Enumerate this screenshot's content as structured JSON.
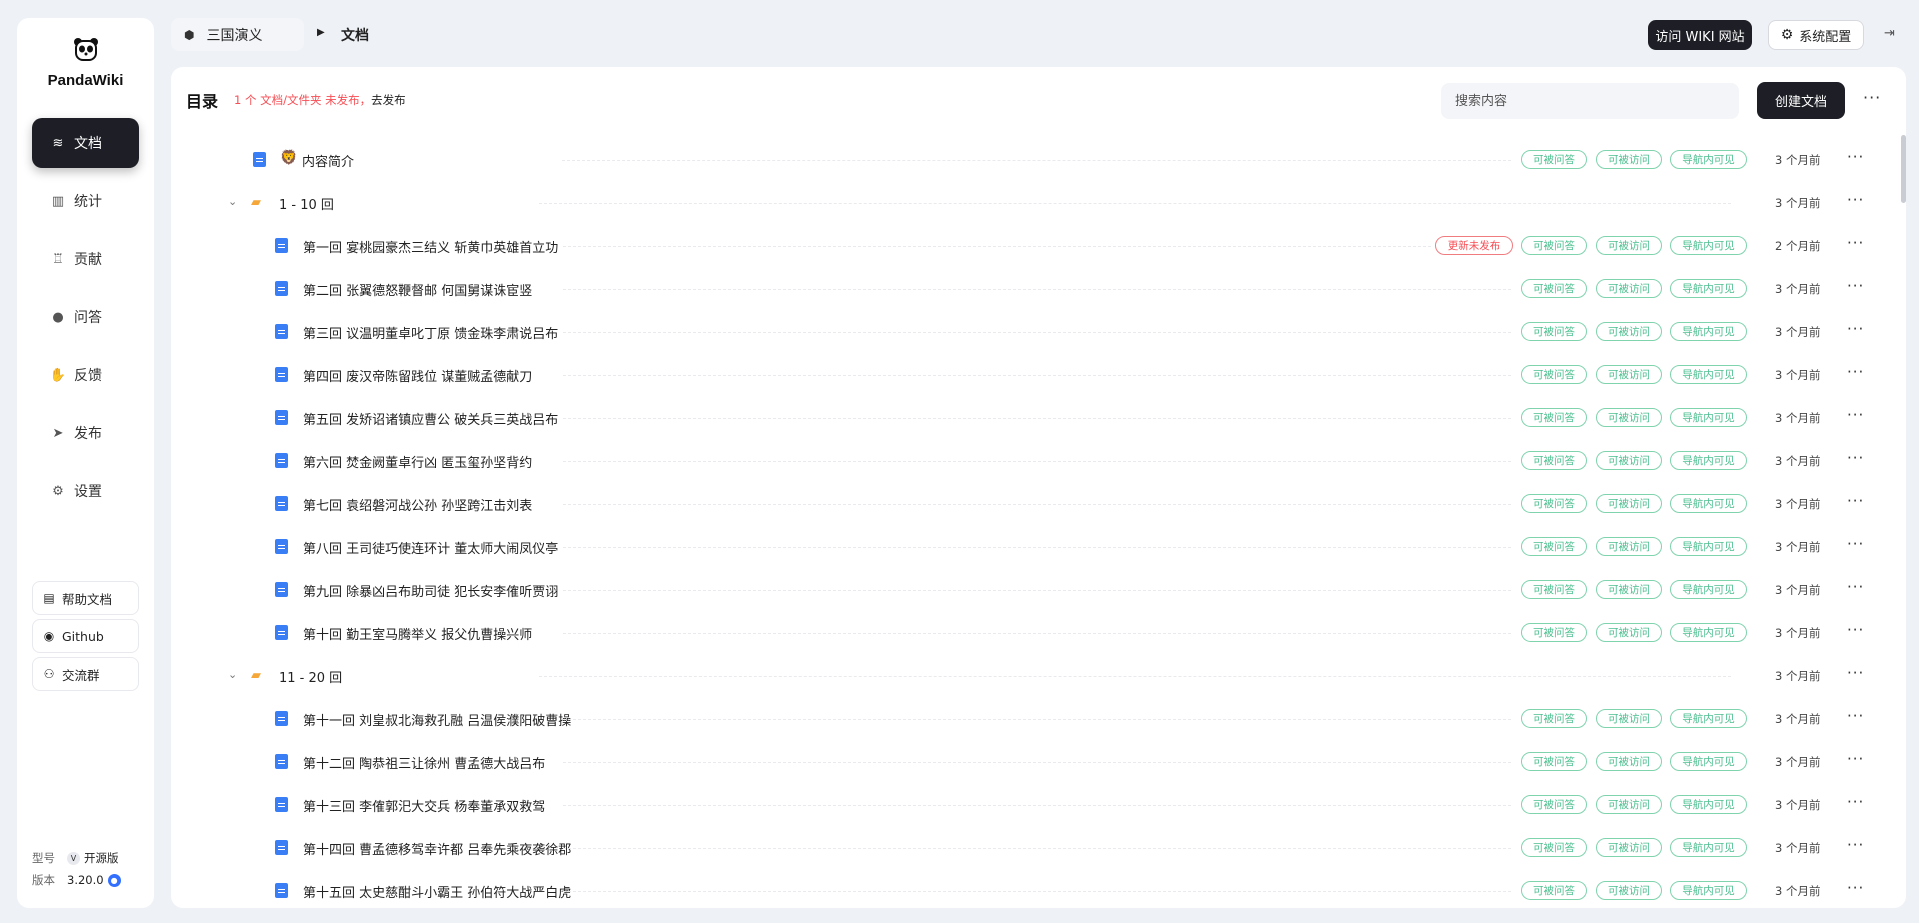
{
  "app": {
    "name": "PandaWiki"
  },
  "sidebar": {
    "items": [
      {
        "label": "文档",
        "icon": "layers-icon",
        "active": true
      },
      {
        "label": "统计",
        "icon": "bar-chart-icon"
      },
      {
        "label": "贡献",
        "icon": "trophy-icon"
      },
      {
        "label": "问答",
        "icon": "chat-bubble-icon"
      },
      {
        "label": "反馈",
        "icon": "hand-icon"
      },
      {
        "label": "发布",
        "icon": "send-icon"
      },
      {
        "label": "设置",
        "icon": "gear-icon"
      }
    ],
    "links": [
      {
        "label": "帮助文档",
        "icon": "document-icon"
      },
      {
        "label": "Github",
        "icon": "github-icon"
      },
      {
        "label": "交流群",
        "icon": "group-icon"
      }
    ],
    "model_label": "型号",
    "model_value": "开源版",
    "version_label": "版本",
    "version_value": "3.20.0"
  },
  "header": {
    "breadcrumb_root": "三国演义",
    "breadcrumb_current": "文档",
    "visit_wiki": "访问 WIKI 网站",
    "system_config": "系统配置"
  },
  "main": {
    "title": "目录",
    "unpublished_notice": "1 个 文档/文件夹 未发布，",
    "unpublished_link": "去发布",
    "search_placeholder": "搜索内容",
    "create_button": "创建文档"
  },
  "tags": {
    "answerable": "可被问答",
    "accessible": "可被访问",
    "nav_visible": "导航内可见",
    "update_unpublished": "更新未发布"
  },
  "colors": {
    "accent": "#1e1f26",
    "tag_green": "#4cbf8f",
    "tag_red": "#f64e54",
    "doc_blue": "#3a7ef5",
    "folder": "#f5a73a"
  },
  "rows": [
    {
      "type": "doc",
      "level": 1,
      "emoji": "🦁",
      "title": "内容简介",
      "time": "3 个月前",
      "tags": true
    },
    {
      "type": "folder",
      "level": 0,
      "title": "1 - 10 回",
      "time": "3 个月前",
      "tags": false
    },
    {
      "type": "doc",
      "level": 2,
      "title": "第一回 宴桃园豪杰三结义 斩黄巾英雄首立功",
      "time": "2 个月前",
      "tags": true,
      "unpublished": true
    },
    {
      "type": "doc",
      "level": 2,
      "title": "第二回 张翼德怒鞭督邮 何国舅谋诛宦竖",
      "time": "3 个月前",
      "tags": true
    },
    {
      "type": "doc",
      "level": 2,
      "title": "第三回 议温明董卓叱丁原 馈金珠李肃说吕布",
      "time": "3 个月前",
      "tags": true
    },
    {
      "type": "doc",
      "level": 2,
      "title": "第四回 废汉帝陈留践位 谋董贼孟德献刀",
      "time": "3 个月前",
      "tags": true
    },
    {
      "type": "doc",
      "level": 2,
      "title": "第五回 发矫诏诸镇应曹公 破关兵三英战吕布",
      "time": "3 个月前",
      "tags": true
    },
    {
      "type": "doc",
      "level": 2,
      "title": "第六回 焚金阙董卓行凶 匿玉玺孙坚背约",
      "time": "3 个月前",
      "tags": true
    },
    {
      "type": "doc",
      "level": 2,
      "title": "第七回 袁绍磐河战公孙 孙坚跨江击刘表",
      "time": "3 个月前",
      "tags": true
    },
    {
      "type": "doc",
      "level": 2,
      "title": "第八回 王司徒巧使连环计 董太师大闹凤仪亭",
      "time": "3 个月前",
      "tags": true
    },
    {
      "type": "doc",
      "level": 2,
      "title": "第九回 除暴凶吕布助司徒 犯长安李傕听贾诩",
      "time": "3 个月前",
      "tags": true
    },
    {
      "type": "doc",
      "level": 2,
      "title": "第十回 勤王室马腾举义 报父仇曹操兴师",
      "time": "3 个月前",
      "tags": true
    },
    {
      "type": "folder",
      "level": 0,
      "title": "11 - 20 回",
      "time": "3 个月前",
      "tags": false
    },
    {
      "type": "doc",
      "level": 2,
      "title": "第十一回 刘皇叔北海救孔融 吕温侯濮阳破曹操",
      "time": "3 个月前",
      "tags": true
    },
    {
      "type": "doc",
      "level": 2,
      "title": "第十二回 陶恭祖三让徐州 曹孟德大战吕布",
      "time": "3 个月前",
      "tags": true
    },
    {
      "type": "doc",
      "level": 2,
      "title": "第十三回 李傕郭汜大交兵 杨奉董承双救驾",
      "time": "3 个月前",
      "tags": true
    },
    {
      "type": "doc",
      "level": 2,
      "title": "第十四回 曹孟德移驾幸许都 吕奉先乘夜袭徐郡",
      "time": "3 个月前",
      "tags": true
    },
    {
      "type": "doc",
      "level": 2,
      "title": "第十五回 太史慈酣斗小霸王 孙伯符大战严白虎",
      "time": "3 个月前",
      "tags": true
    }
  ]
}
